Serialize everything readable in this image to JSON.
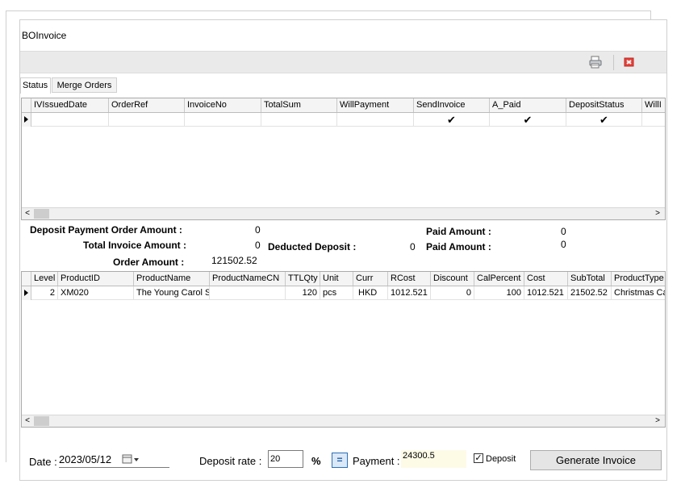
{
  "window": {
    "title": "BOInvoice"
  },
  "toolbar": {
    "print_icon": "printer-icon",
    "close_icon": "close-icon"
  },
  "tabs": [
    {
      "label": "Status"
    },
    {
      "label": "Merge Orders"
    }
  ],
  "orders_grid": {
    "columns": [
      "IVIssuedDate",
      "OrderRef",
      "InvoiceNo",
      "TotalSum",
      "WillPayment",
      "SendInvoice",
      "A_Paid",
      "DepositStatus",
      "WillI"
    ],
    "checks": [
      "✔",
      "✔",
      "✔"
    ]
  },
  "summary": {
    "deposit_payment_order_amount_label": "Deposit Payment Order Amount :",
    "deposit_payment_order_amount_value": "0",
    "total_invoice_amount_label": "Total Invoice Amount :",
    "total_invoice_amount_value": "0",
    "order_amount_label": "Order Amount :",
    "order_amount_value": "121502.52",
    "deducted_deposit_label": "Deducted Deposit :",
    "deducted_deposit_value": "0",
    "paid_amount_label_1": "Paid  Amount :",
    "paid_amount_value_1": "0",
    "paid_amount_label_2": "Paid  Amount :",
    "paid_amount_value_2": "0"
  },
  "products_grid": {
    "columns": [
      "Level",
      "ProductID",
      "ProductName",
      "ProductNameCN",
      "TTLQty",
      "Unit",
      "Curr",
      "RCost",
      "Discount",
      "CalPercent",
      "Cost",
      "SubTotal",
      "ProductType"
    ],
    "row": {
      "level": "2",
      "product_id": "XM020",
      "product_name": "The Young Carol Singers",
      "product_name_cn": "",
      "ttl_qty": "120",
      "unit": "pcs",
      "curr": "HKD",
      "rcost": "1012.521",
      "discount": "0",
      "cal_percent": "100",
      "cost": "1012.521",
      "subtotal": "21502.52",
      "product_type": "Christmas Cards"
    }
  },
  "bottom_bar": {
    "date_label": "Date :",
    "date_value": "2023/05/12",
    "deposit_rate_label": "Deposit rate  :",
    "deposit_rate_value": "20",
    "percent_label": "%",
    "equals_label": "=",
    "payment_label": "Payment :",
    "payment_value": "24300.5",
    "deposit_checkbox_label": "Deposit",
    "deposit_checked": "✓",
    "generate_invoice_label": "Generate Invoice"
  }
}
